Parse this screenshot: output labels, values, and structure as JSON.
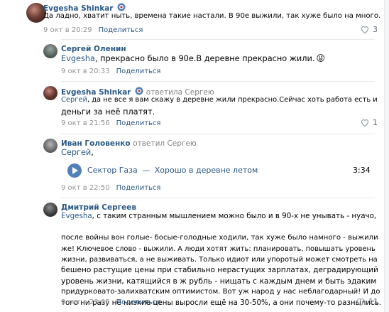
{
  "comments": [
    {
      "author": "Evgesha Shinkar",
      "text": "Да ладно, хватит ныть, времена такие настали. В 90е выжили, так хуже было на много.",
      "date": "9 окт в 20:29",
      "share": "Поделиться",
      "likes": "3"
    },
    {
      "author": "Сергей Оленин",
      "mention": "Evgesha",
      "text": ", прекрасно было в 90е.В деревне прекрасно жили.",
      "emoji": "😜",
      "date": "9 окт в 20:33",
      "share": "Поделиться"
    },
    {
      "author": "Evgesha Shinkar",
      "reply_to": "ответила Сергею",
      "mention": "Сергей",
      "text_line1": ", да не все я вам скажу в деревне жили прекрасно.Сейчас хоть работа есть и",
      "text_line2": "деньги за неё платят.",
      "date": "9 окт в 21:56",
      "share": "Поделиться",
      "likes": "1"
    },
    {
      "author": "Иван Головенко",
      "reply_to": "ответил Сергею",
      "mention": "Сергей",
      "mention_suffix": ",",
      "audio": {
        "artist": "Сектор Газа",
        "dash": "—",
        "title": "Хорошо в деревне летом",
        "duration": "3:34"
      },
      "date": "9 окт в 22:50",
      "share": "Поделиться"
    },
    {
      "author": "Дмитрий Сергеев",
      "mention": "Evgesha",
      "lines": [
        ", с таким странным мышлением можно было и в 90-х не унывать - нуачо,",
        "после войны вон голые- босые-голодные ходили, так хуже было намного - выжили",
        "же! Ключевое слово - выжили. А люди хотят жить: планировать, повышать уровень",
        "жизни, развиваться, а не выживать. Только идиот или упоротый может смотреть на",
        "бешено растущие цены при стабильно нерастущих зарплатах, деградирующий",
        "уровень жизни, катящийся в ж рубль - нищать с каждым днем и быть эдаким",
        "придурковато-залихватским оптимистом. Вот уж народ у нас неблагодарный! И до",
        "того ни разу не низкие цены выросли ещё на 30-50%, а они почему-то разнылись."
      ],
      "date": "9 окт в 23:05",
      "share": "Поделиться",
      "likes": "11"
    }
  ],
  "colors": {
    "link": "#2a5885",
    "meta": "#939393",
    "heart": "#8b96a3",
    "play": "#5181b8"
  }
}
